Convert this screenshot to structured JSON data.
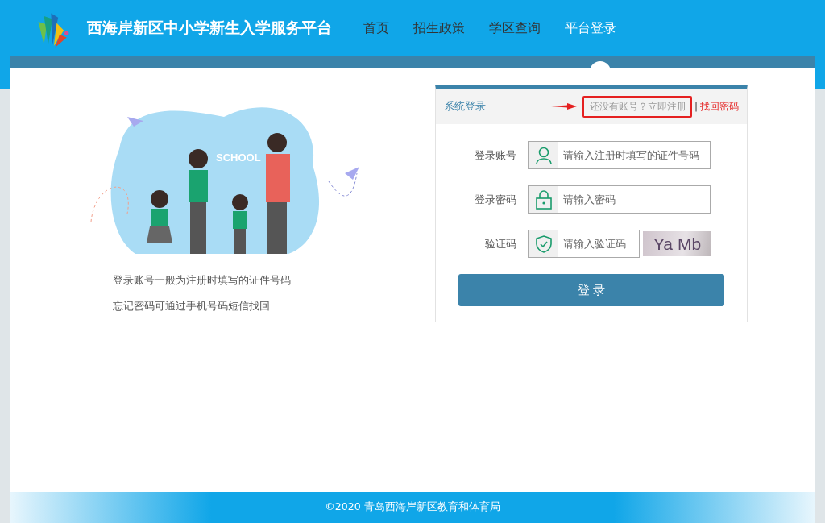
{
  "header": {
    "title": "西海岸新区中小学新生入学服务平台"
  },
  "nav": [
    {
      "label": "首页",
      "selected": false
    },
    {
      "label": "招生政策",
      "selected": false
    },
    {
      "label": "学区查询",
      "selected": false
    },
    {
      "label": "平台登录",
      "selected": true
    }
  ],
  "illustration": {
    "caption": "SCHOOL"
  },
  "notes": [
    "登录账号一般为注册时填写的证件号码",
    "忘记密码可通过手机号码短信找回"
  ],
  "login": {
    "title": "系统登录",
    "register_link": "还没有账号？立即注册",
    "separator": "|",
    "recover_link": "找回密码",
    "fields": [
      {
        "label": "登录账号",
        "kind": "user",
        "placeholder": "请输入注册时填写的证件号码"
      },
      {
        "label": "登录密码",
        "kind": "lock",
        "placeholder": "请输入密码"
      },
      {
        "label": "验证码",
        "kind": "captcha",
        "placeholder": "请输入验证码",
        "captcha": "Ya Mb"
      }
    ],
    "submit": "登 录"
  },
  "footer": "©2020 青岛西海岸新区教育和体育局"
}
